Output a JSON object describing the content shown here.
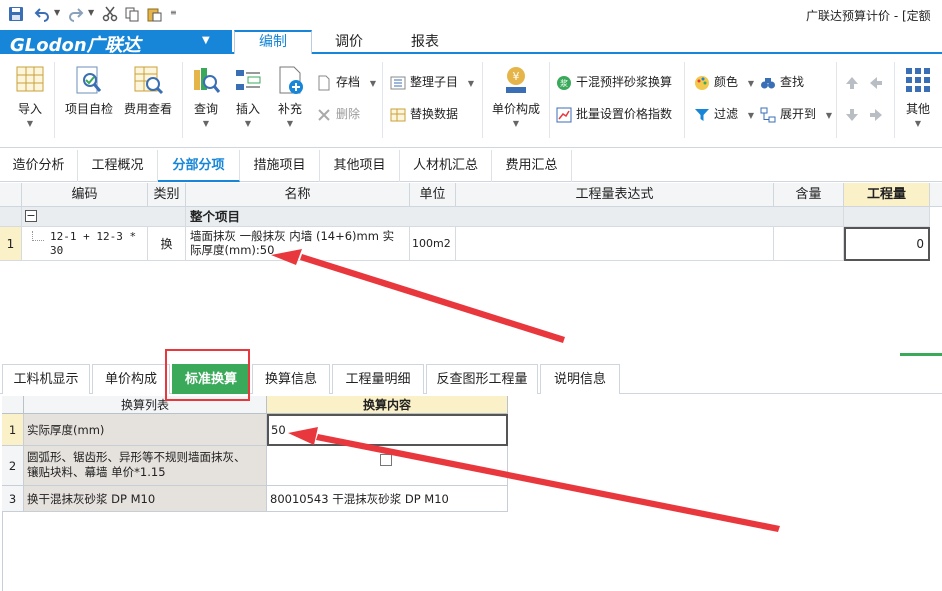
{
  "window": {
    "title": "广联达预算计价 - [定额"
  },
  "brand": {
    "logo": "GLodon广联达",
    "menu_arrow": "▼"
  },
  "main_tabs": [
    {
      "label": "编制",
      "active": true
    },
    {
      "label": "调价",
      "active": false
    },
    {
      "label": "报表",
      "active": false
    }
  ],
  "ribbon": {
    "import": "导入",
    "self_check": "项目自检",
    "fee_view": "费用查看",
    "query": "查询",
    "insert": "插入",
    "supplement": "补充",
    "archive": "存档",
    "delete": "删除",
    "organize_sub": "整理子目",
    "replace_data": "替换数据",
    "unit_price": "单价构成",
    "dry_mortar": "干混预拌砂浆换算",
    "batch_price_index": "批量设置价格指数",
    "color": "颜色",
    "find": "查找",
    "filter": "过滤",
    "expand_to": "展开到",
    "other": "其他"
  },
  "sub_tabs": [
    "造价分析",
    "工程概况",
    "分部分项",
    "措施项目",
    "其他项目",
    "人材机汇总",
    "费用汇总"
  ],
  "sub_tab_active": "分部分项",
  "grid": {
    "headers": [
      "编码",
      "类别",
      "名称",
      "单位",
      "工程量表达式",
      "含量",
      "工程量"
    ],
    "group_toggle": "−",
    "group_label": "整个项目",
    "row": {
      "num": "1",
      "code_line1": "12-1 + 12-3 *",
      "code_line2": "30",
      "category": "换",
      "name_line1": "墙面抹灰 一般抹灰 内墙 (14+6)mm  实",
      "name_line2": "际厚度(mm):50",
      "unit": "100m2",
      "expression": "",
      "content": "",
      "quantity": "0"
    }
  },
  "lower_tabs": [
    {
      "label": "工料机显示",
      "active": false
    },
    {
      "label": "单价构成",
      "active": false
    },
    {
      "label": "标准换算",
      "active": true
    },
    {
      "label": "换算信息",
      "active": false
    },
    {
      "label": "工程量明细",
      "active": false
    },
    {
      "label": "反查图形工程量",
      "active": false
    },
    {
      "label": "说明信息",
      "active": false
    }
  ],
  "lower_grid": {
    "headers": [
      "换算列表",
      "换算内容"
    ],
    "rows": [
      {
        "num": "1",
        "item": "实际厚度(mm)",
        "value": "50"
      },
      {
        "num": "2",
        "item_line1": "圆弧形、锯齿形、异形等不规则墙面抹灰、",
        "item_line2": "镶贴块料、幕墙 单价*1.15",
        "checked": false
      },
      {
        "num": "3",
        "item": "换干混抹灰砂浆 DP M10",
        "value": "80010543  干混抹灰砂浆 DP M10"
      }
    ]
  },
  "colors": {
    "brand_blue": "#1786d8",
    "active_green": "#3aaa5a",
    "highlight_header": "#fbf1c8",
    "annotation_red": "#e8383d"
  }
}
